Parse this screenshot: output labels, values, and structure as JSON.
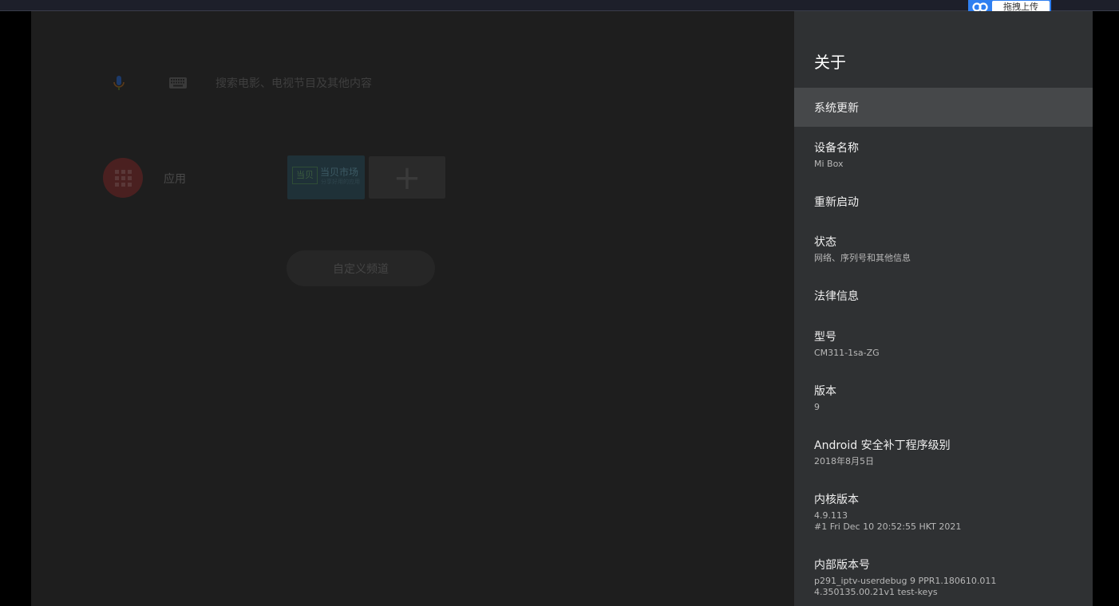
{
  "upload_widget": {
    "label": "拖拽上传",
    "icon": "cloud-link-icon"
  },
  "home": {
    "search_placeholder": "搜索电影、电视节目及其他内容",
    "apps_label": "应用",
    "tile": {
      "logo": "当贝",
      "name": "当贝市场",
      "sub": "分享好用的应用"
    },
    "custom_channels": "自定义频道"
  },
  "panel": {
    "title": "关于",
    "items": [
      {
        "title": "系统更新"
      },
      {
        "title": "设备名称",
        "sub": "Mi Box"
      },
      {
        "title": "重新启动"
      },
      {
        "title": "状态",
        "sub": "网络、序列号和其他信息"
      },
      {
        "title": "法律信息"
      },
      {
        "title": "型号",
        "sub": "CM311-1sa-ZG"
      },
      {
        "title": "版本",
        "sub": "9"
      },
      {
        "title": "Android 安全补丁程序级别",
        "sub": "2018年8月5日"
      },
      {
        "title": "内核版本",
        "sub": "4.9.113",
        "sub2": "#1 Fri Dec 10 20:52:55 HKT 2021"
      },
      {
        "title": "内部版本号",
        "sub": "p291_iptv-userdebug 9 PPR1.180610.011",
        "sub2": "4.350135.00.21v1 test-keys"
      }
    ]
  }
}
